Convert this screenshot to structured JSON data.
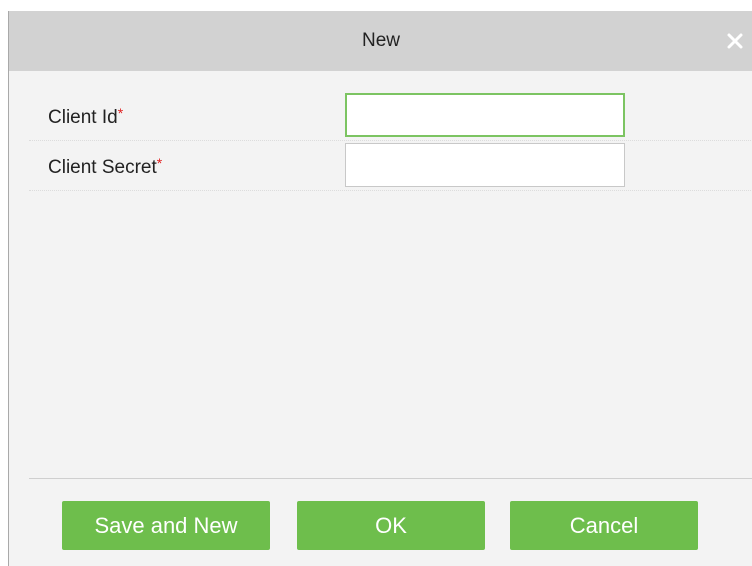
{
  "dialog": {
    "title": "New",
    "close_icon": "close-icon"
  },
  "form": {
    "fields": [
      {
        "label": "Client Id",
        "required_mark": "*",
        "value": "",
        "focused": true
      },
      {
        "label": "Client Secret",
        "required_mark": "*",
        "value": "",
        "focused": false
      }
    ]
  },
  "buttons": {
    "save_and_new": "Save and New",
    "ok": "OK",
    "cancel": "Cancel"
  },
  "colors": {
    "accent_green": "#6ebe4c",
    "focus_green": "#7cc462",
    "required_red": "#e02020",
    "titlebar": "#d2d2d2"
  }
}
